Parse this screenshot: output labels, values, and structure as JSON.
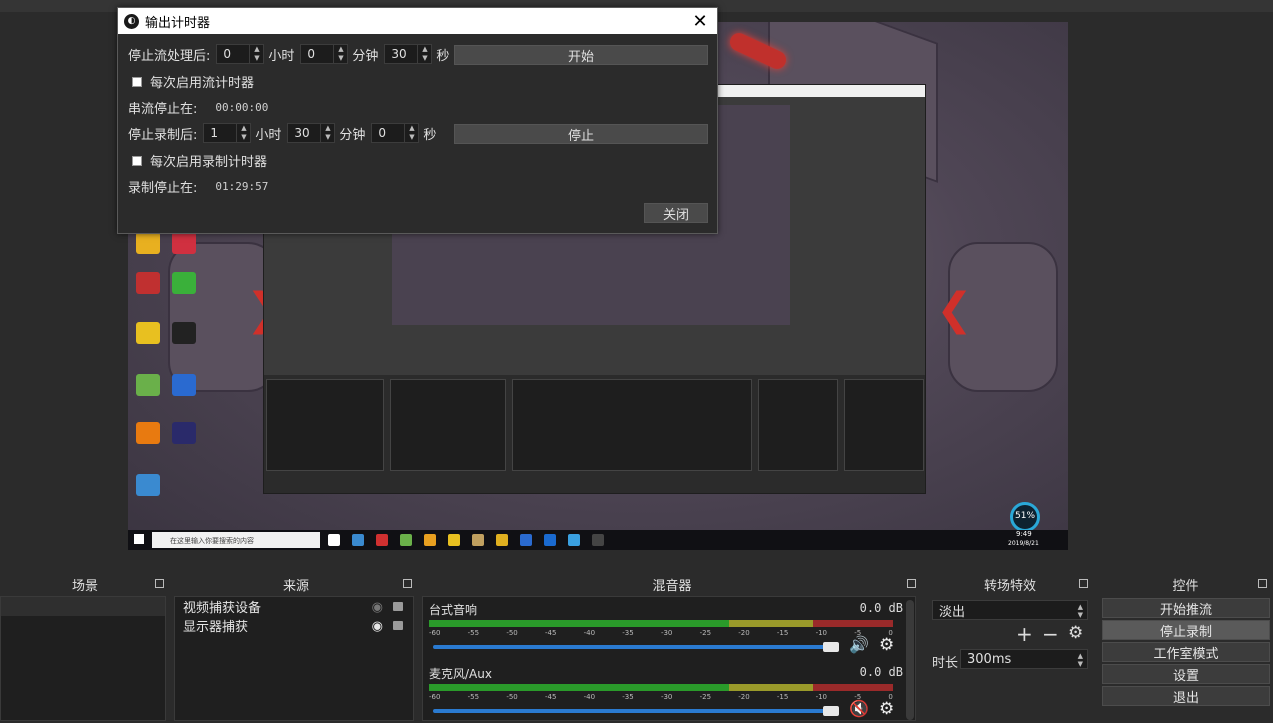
{
  "preview": {
    "taskbar_search": "在这里输入你要搜索的内容",
    "clock_time": "9:49",
    "clock_date": "2019/8/21",
    "gauge_value": "51%"
  },
  "dialog": {
    "title": "输出计时器",
    "close_glyph": "✕",
    "stream": {
      "label": "停止流处理后:",
      "hours": "0",
      "hours_unit": "小时",
      "minutes": "0",
      "minutes_unit": "分钟",
      "seconds": "30",
      "seconds_unit": "秒",
      "button": "开始",
      "auto_check_label": "每次启用流计时器",
      "status_label": "串流停止在:",
      "status_value": "00:00:00"
    },
    "record": {
      "label": "停止录制后:",
      "hours": "1",
      "hours_unit": "小时",
      "minutes": "30",
      "minutes_unit": "分钟",
      "seconds": "0",
      "seconds_unit": "秒",
      "button": "停止",
      "auto_check_label": "每次启用录制计时器",
      "status_label": "录制停止在:",
      "status_value": "01:29:57"
    },
    "close_button": "关闭"
  },
  "docks": {
    "scenes": {
      "title": "场景"
    },
    "sources": {
      "title": "来源",
      "items": [
        {
          "label": "视频捕获设备",
          "visible": false
        },
        {
          "label": "显示器捕获",
          "visible": true
        }
      ]
    },
    "mixer": {
      "title": "混音器",
      "channels": [
        {
          "name": "台式音响",
          "db": "0.0 dB",
          "muted": false
        },
        {
          "name": "麦克风/Aux",
          "db": "0.0 dB",
          "muted": true
        }
      ],
      "ticks": [
        "-60",
        "-55",
        "-50",
        "-45",
        "-40",
        "-35",
        "-30",
        "-25",
        "-20",
        "-15",
        "-10",
        "-5",
        "0"
      ]
    },
    "transitions": {
      "title": "转场特效",
      "selected": "淡出",
      "duration_label": "时长",
      "duration_value": "300ms"
    },
    "controls": {
      "title": "控件",
      "buttons": [
        "开始推流",
        "停止录制",
        "工作室模式",
        "设置",
        "退出"
      ]
    }
  }
}
